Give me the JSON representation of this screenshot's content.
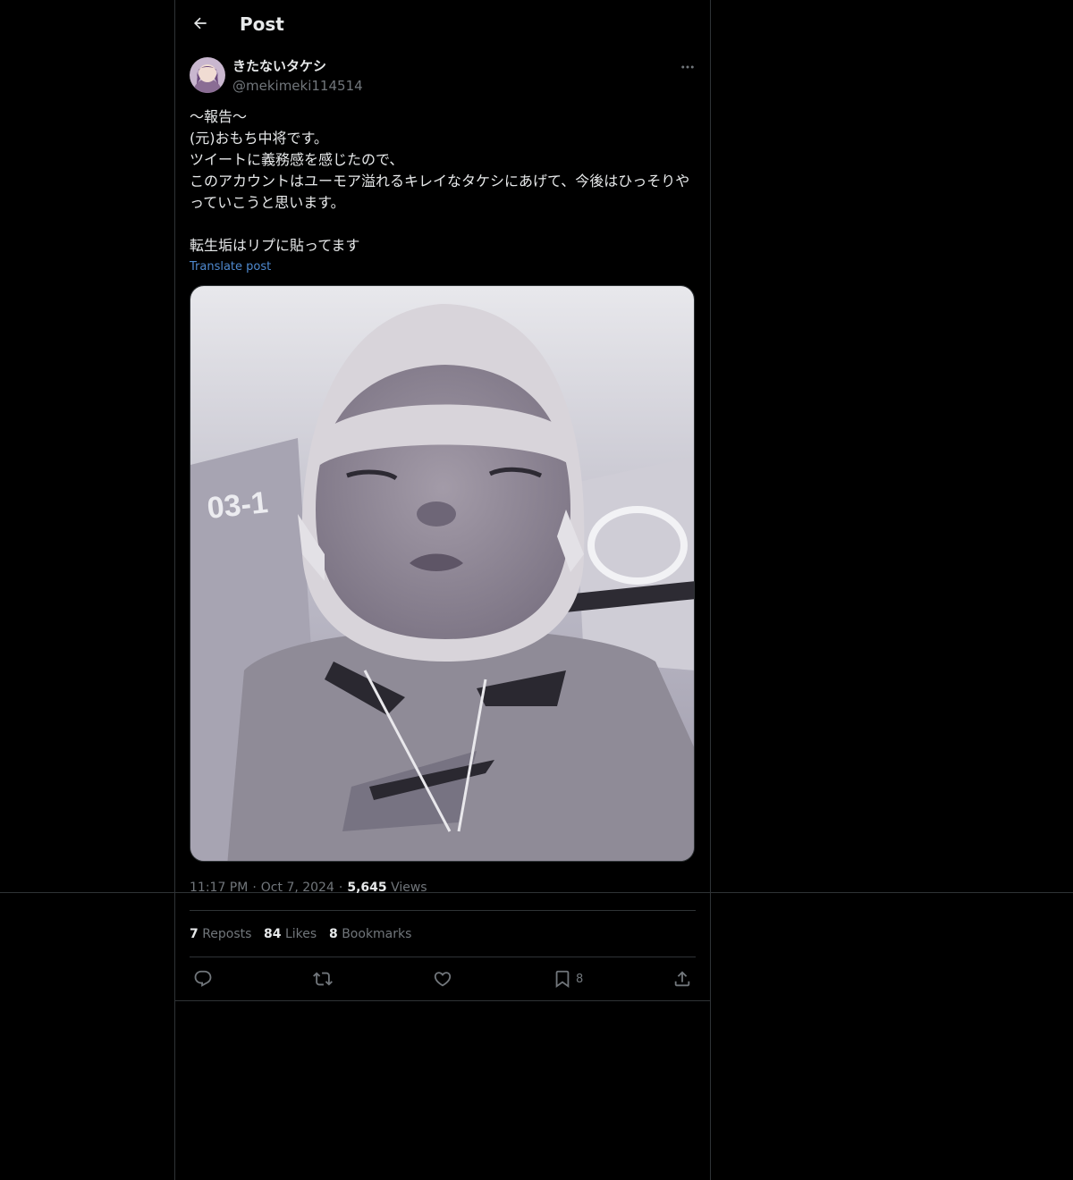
{
  "header": {
    "title": "Post"
  },
  "post": {
    "author": {
      "display_name": "きたないタケシ",
      "handle": "@mekimeki114514"
    },
    "text": "〜報告〜\n(元)おもち中将です。\nツイートに義務感を感じたので、\nこのアカウントはユーモア溢れるキレイなタケシにあげて、今後はひっそりやっていこうと思います。\n\n転生垢はリプに貼ってます",
    "translate_label": "Translate post",
    "time": "11:17 PM",
    "date": "Oct 7, 2024",
    "separator": "·",
    "views_count": "5,645",
    "views_label": "Views"
  },
  "stats": {
    "reposts_count": "7",
    "reposts_label": "Reposts",
    "likes_count": "84",
    "likes_label": "Likes",
    "bookmarks_count": "8",
    "bookmarks_label": "Bookmarks"
  },
  "actions": {
    "bookmark_count": "8"
  },
  "colors": {
    "background": "#000000",
    "text_primary": "#e7e9ea",
    "text_secondary": "#71767b",
    "link": "#4f8ad0",
    "border": "#2f3336"
  },
  "icons": {
    "back": "arrow-left-icon",
    "more": "more-horizontal-icon",
    "reply": "reply-icon",
    "repost": "repost-icon",
    "like": "heart-icon",
    "bookmark": "bookmark-icon",
    "share": "share-icon"
  }
}
